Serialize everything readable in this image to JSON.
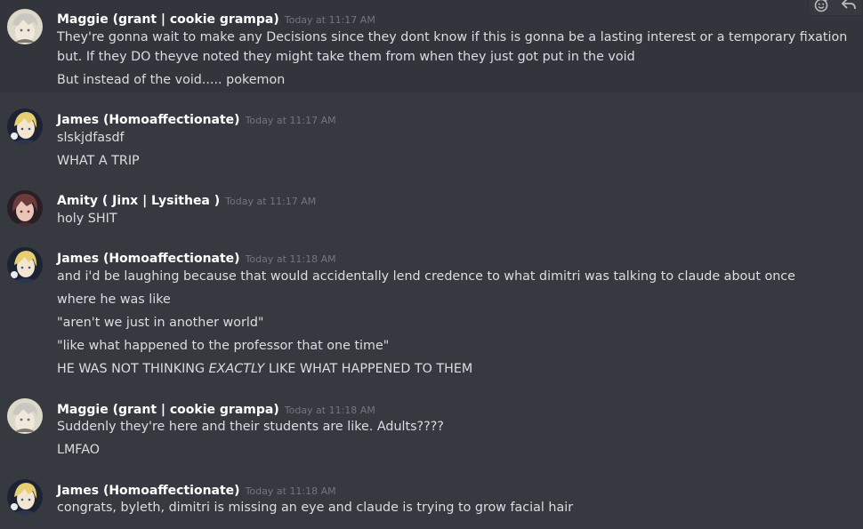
{
  "toolbar": {
    "icons": [
      "add-reaction-icon",
      "reply-icon"
    ]
  },
  "messages": [
    {
      "author": "Maggie (grant | cookie grampa)",
      "timestamp": "Today at 11:17 AM",
      "avatar": "maggie-avatar",
      "lines": [
        "They're gonna wait to make any Decisions since they dont know if this is gonna be a lasting interest or a temporary fixation but. If they DO theyve noted they might take them from when they just got put in the void",
        "But instead of the void..... pokemon"
      ]
    },
    {
      "author": "James (Homoaffectionate)",
      "timestamp": "Today at 11:17 AM",
      "avatar": "james-avatar",
      "lines": [
        "slskjdfasdf",
        "WHAT A TRIP"
      ]
    },
    {
      "author": "Amity ( Jinx | Lysithea )",
      "timestamp": "Today at 11:17 AM",
      "avatar": "amity-avatar",
      "lines": [
        "holy SHIT"
      ]
    },
    {
      "author": "James (Homoaffectionate)",
      "timestamp": "Today at 11:18 AM",
      "avatar": "james-avatar",
      "lines": [
        "and i'd be laughing because that would accidentally lend credence to what dimitri was talking to claude about once",
        "where he was like",
        "\"aren't we just in another world\"",
        "\"like what happened to the professor that one time\"",
        {
          "pre": "HE WAS NOT THINKING ",
          "em": "EXACTLY",
          "post": " LIKE WHAT HAPPENED TO THEM"
        }
      ]
    },
    {
      "author": "Maggie (grant | cookie grampa)",
      "timestamp": "Today at 11:18 AM",
      "avatar": "maggie-avatar",
      "lines": [
        "Suddenly they're here and their students are like. Adults????",
        "LMFAO"
      ]
    },
    {
      "author": "James (Homoaffectionate)",
      "timestamp": "Today at 11:18 AM",
      "avatar": "james-avatar",
      "lines": [
        "congrats, byleth, dimitri is missing an eye and claude is trying to grow facial hair"
      ]
    }
  ]
}
